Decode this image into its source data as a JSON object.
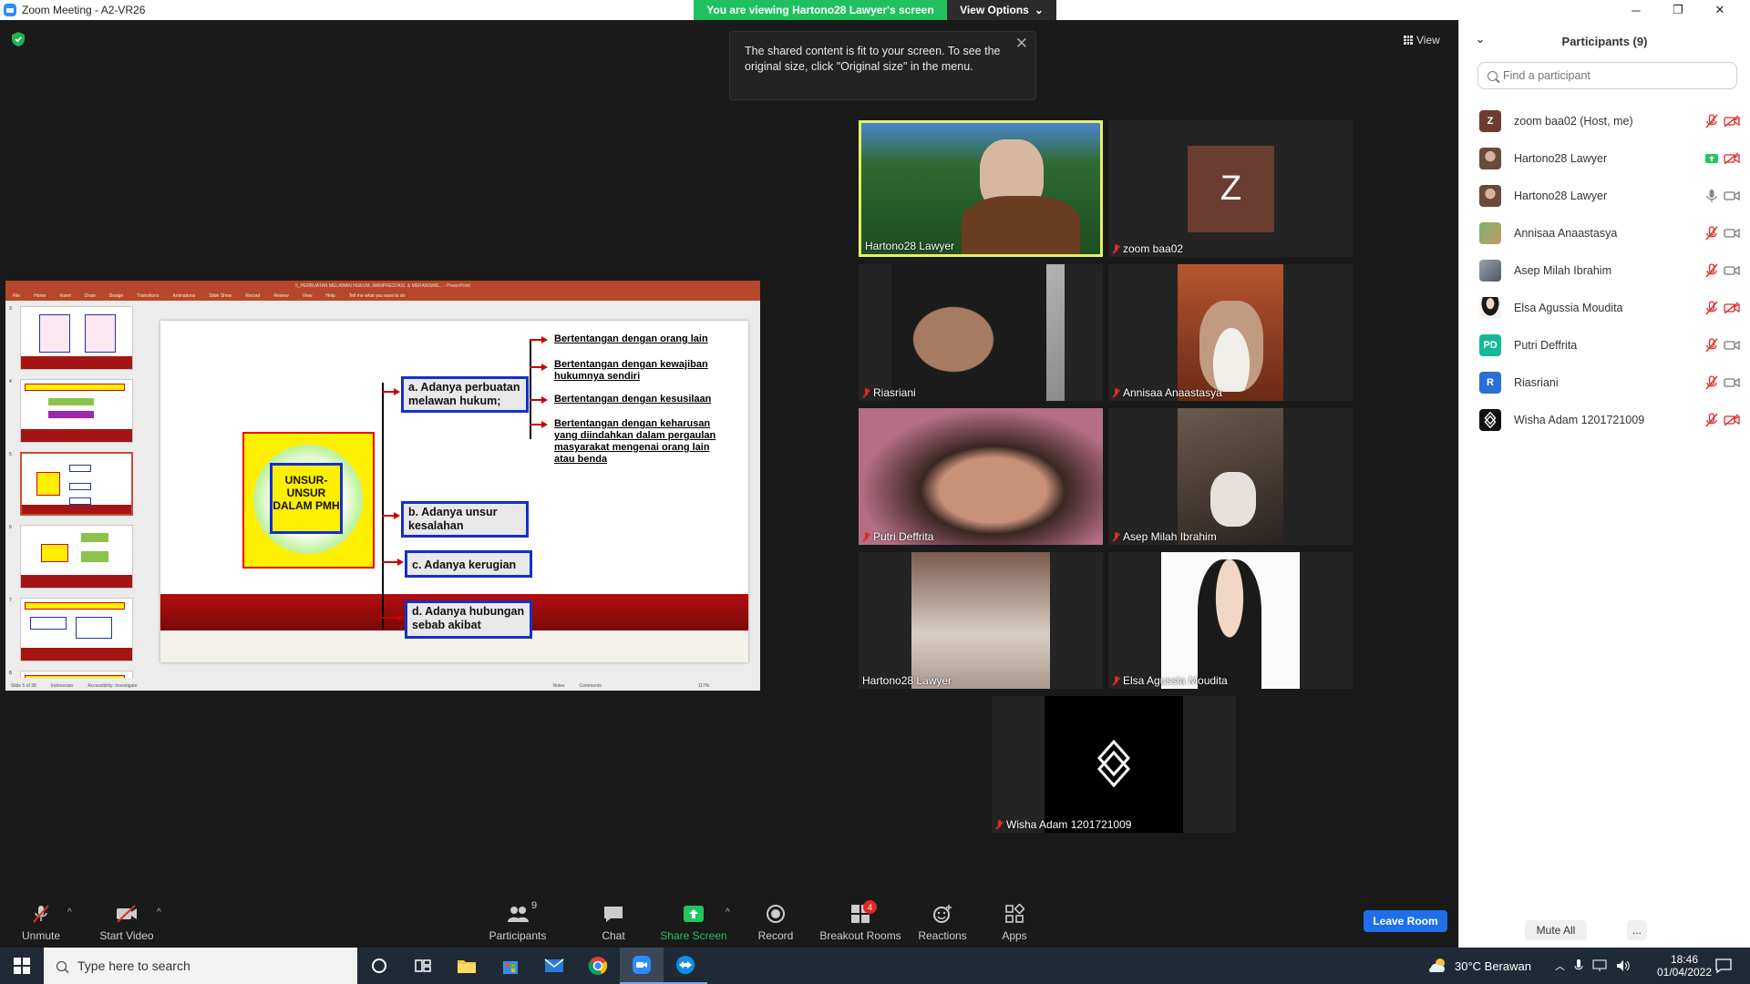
{
  "window": {
    "title": "Zoom Meeting - A2-VR26",
    "minimize": "─",
    "restore": "❐",
    "close": "✕"
  },
  "banner": {
    "viewing": "You are viewing Hartono28 Lawyer's screen",
    "view_options": "View Options",
    "view_options_caret": "⌄"
  },
  "tooltip": {
    "text": "The shared content is fit to your screen. To see the original size, click \"Original size\" in the menu.",
    "close": "✕"
  },
  "view_button": {
    "label": "View"
  },
  "powerpoint": {
    "title": "5_PERBUATAN MELAWAN HUKUM, WANPRESTASI, & MEKANISME... - PowerPoint",
    "menu": [
      "File",
      "Home",
      "Insert",
      "Draw",
      "Design",
      "Transitions",
      "Animations",
      "Slide Show",
      "Record",
      "Review",
      "View",
      "Help",
      "Tell me what you want to do"
    ],
    "thumb_numbers": [
      "3",
      "4",
      "5",
      "6",
      "7",
      "8"
    ],
    "status": [
      "Slide 5 of 38",
      "Indonesian",
      "Accessibility: Investigate",
      "Notes",
      "Comments",
      "117%"
    ],
    "slide": {
      "center_text": "UNSUR-UNSUR DALAM PMH",
      "item_a": "a.  Adanya perbuatan melawan hukum;",
      "item_b": "b. Adanya unsur kesalahan",
      "item_c": "c. Adanya kerugian",
      "item_d": "d. Adanya hubungan sebab akibat",
      "branches": [
        "Bertentangan dengan orang lain",
        "Bertentangan dengan kewajiban hukumnya sendiri",
        "Bertentangan dengan kesusilaan",
        "Bertentangan dengan keharusan yang diindahkan dalam pergaulan masyarakat mengenai orang lain atau benda"
      ]
    }
  },
  "tiles": [
    {
      "name": "Hartono28 Lawyer",
      "muted": false,
      "active": true
    },
    {
      "name": "zoom baa02",
      "muted": true,
      "avatar_letter": "Z"
    },
    {
      "name": "Riasriani",
      "muted": true
    },
    {
      "name": "Annisaa Anaastasya",
      "muted": true
    },
    {
      "name": "Putri Deffrita",
      "muted": true
    },
    {
      "name": "Asep Milah Ibrahim",
      "muted": true
    },
    {
      "name": "Hartono28 Lawyer",
      "muted": false
    },
    {
      "name": "Elsa Agussia Moudita",
      "muted": true
    },
    {
      "name": "Wisha Adam 1201721009",
      "muted": true
    }
  ],
  "toolbar": {
    "unmute": "Unmute",
    "start_video": "Start Video",
    "participants": "Participants",
    "participants_count": "9",
    "chat": "Chat",
    "share_screen": "Share Screen",
    "record": "Record",
    "breakout_rooms": "Breakout Rooms",
    "breakout_badge": "4",
    "reactions": "Reactions",
    "apps": "Apps",
    "leave": "Leave Room",
    "caret": "^"
  },
  "panel": {
    "title": "Participants (9)",
    "search_placeholder": "Find a participant",
    "participants": [
      {
        "name": "zoom baa02 (Host, me)",
        "avatar": "Z",
        "color": "#6b3d31",
        "mic": "muted",
        "cam": "off"
      },
      {
        "name": "Hartono28 Lawyer",
        "avatar": "",
        "color": "#8a6d5a",
        "mic": "sharing",
        "cam": "off"
      },
      {
        "name": "Hartono28 Lawyer",
        "avatar": "",
        "color": "#8a6d5a",
        "mic": "on",
        "cam": "on"
      },
      {
        "name": "Annisaa Anaastasya",
        "avatar": "",
        "color": "#5a8f6b",
        "mic": "muted",
        "cam": "on"
      },
      {
        "name": "Asep Milah Ibrahim",
        "avatar": "",
        "color": "#6a7a8a",
        "mic": "muted",
        "cam": "on"
      },
      {
        "name": "Elsa Agussia Moudita",
        "avatar": "",
        "color": "#f2e6e0",
        "mic": "muted",
        "cam": "off"
      },
      {
        "name": "Putri Deffrita",
        "avatar": "PD",
        "color": "#14b89a",
        "mic": "muted",
        "cam": "on"
      },
      {
        "name": "Riasriani",
        "avatar": "R",
        "color": "#2a6fd4",
        "mic": "muted",
        "cam": "on"
      },
      {
        "name": "Wisha Adam 1201721009",
        "avatar": "",
        "color": "#111111",
        "mic": "muted",
        "cam": "off"
      }
    ],
    "mute_all": "Mute All",
    "more": "..."
  },
  "taskbar": {
    "search_placeholder": "Type here to search",
    "weather": "30°C  Berawan",
    "time": "18:46",
    "date": "01/04/2022"
  }
}
